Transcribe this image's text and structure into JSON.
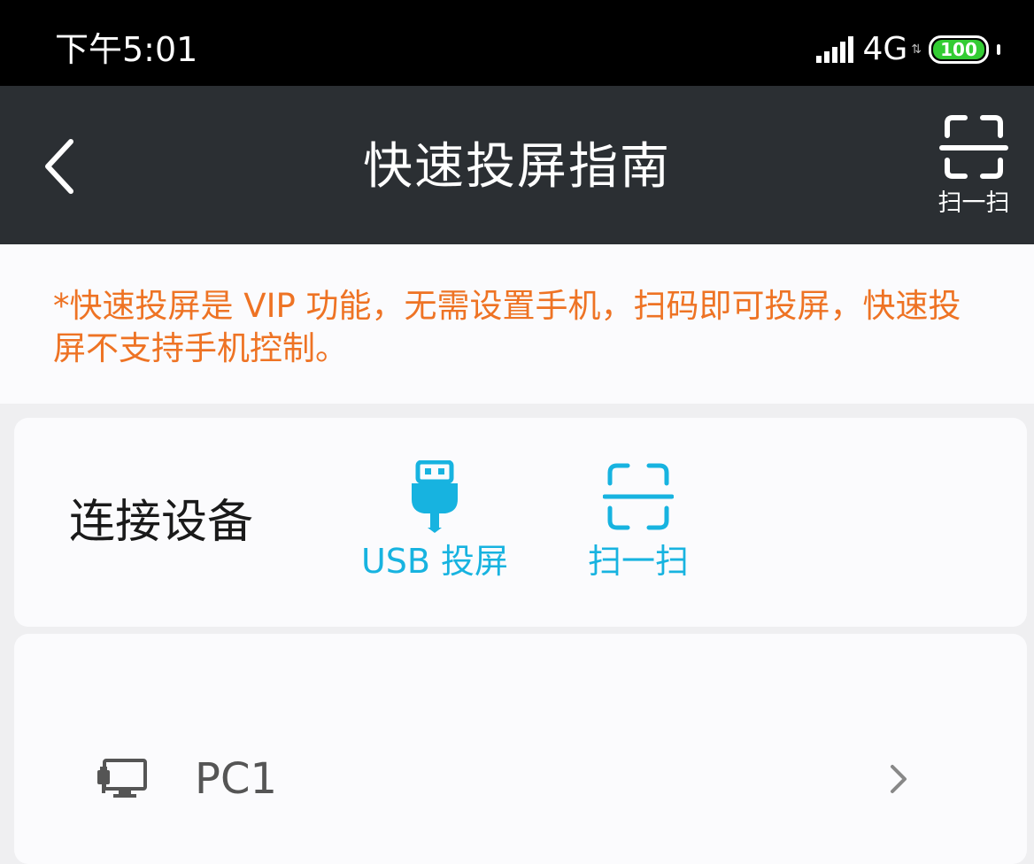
{
  "status_bar": {
    "time": "下午5:01",
    "network": "4G",
    "battery": "100",
    "battery_color": "#33cc33"
  },
  "header": {
    "title": "快速投屏指南",
    "scan_label": "扫一扫",
    "back_icon": "chevron-left-icon",
    "scan_icon": "scan-frame-icon"
  },
  "notice": {
    "text": "*快速投屏是 VIP 功能，无需设置手机，扫码即可投屏，快速投屏不支持手机控制。",
    "color": "#ee7324"
  },
  "connect": {
    "label": "连接设备",
    "options": [
      {
        "label": "USB 投屏",
        "icon": "usb-plug-icon"
      },
      {
        "label": "扫一扫",
        "icon": "scan-frame-icon"
      }
    ],
    "accent_color": "#17b3e0"
  },
  "devices": [
    {
      "name": "PC1",
      "icon": "pc-usb-icon"
    }
  ]
}
